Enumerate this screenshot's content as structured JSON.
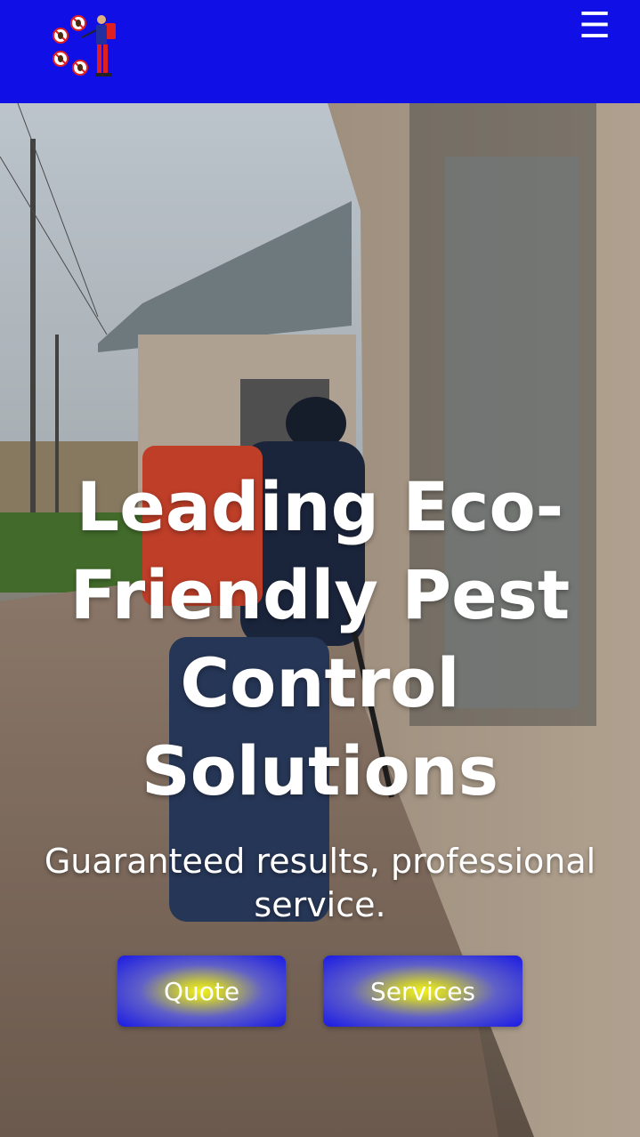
{
  "header": {
    "logo_icon": "pest-control-logo",
    "menu_icon_glyph": "☰",
    "background_color": "#1010e6"
  },
  "hero": {
    "headline": "Leading Eco-Friendly Pest Control Solutions",
    "subline": "Guaranteed results, professional service.",
    "buttons": {
      "quote_label": "Quote",
      "services_label": "Services"
    }
  }
}
